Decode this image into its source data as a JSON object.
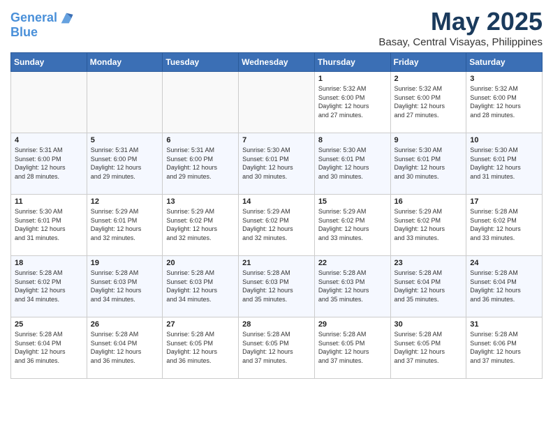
{
  "header": {
    "logo_line1": "General",
    "logo_line2": "Blue",
    "month_year": "May 2025",
    "location": "Basay, Central Visayas, Philippines"
  },
  "weekdays": [
    "Sunday",
    "Monday",
    "Tuesday",
    "Wednesday",
    "Thursday",
    "Friday",
    "Saturday"
  ],
  "weeks": [
    [
      {
        "day": "",
        "content": ""
      },
      {
        "day": "",
        "content": ""
      },
      {
        "day": "",
        "content": ""
      },
      {
        "day": "",
        "content": ""
      },
      {
        "day": "1",
        "content": "Sunrise: 5:32 AM\nSunset: 6:00 PM\nDaylight: 12 hours\nand 27 minutes."
      },
      {
        "day": "2",
        "content": "Sunrise: 5:32 AM\nSunset: 6:00 PM\nDaylight: 12 hours\nand 27 minutes."
      },
      {
        "day": "3",
        "content": "Sunrise: 5:32 AM\nSunset: 6:00 PM\nDaylight: 12 hours\nand 28 minutes."
      }
    ],
    [
      {
        "day": "4",
        "content": "Sunrise: 5:31 AM\nSunset: 6:00 PM\nDaylight: 12 hours\nand 28 minutes."
      },
      {
        "day": "5",
        "content": "Sunrise: 5:31 AM\nSunset: 6:00 PM\nDaylight: 12 hours\nand 29 minutes."
      },
      {
        "day": "6",
        "content": "Sunrise: 5:31 AM\nSunset: 6:00 PM\nDaylight: 12 hours\nand 29 minutes."
      },
      {
        "day": "7",
        "content": "Sunrise: 5:30 AM\nSunset: 6:01 PM\nDaylight: 12 hours\nand 30 minutes."
      },
      {
        "day": "8",
        "content": "Sunrise: 5:30 AM\nSunset: 6:01 PM\nDaylight: 12 hours\nand 30 minutes."
      },
      {
        "day": "9",
        "content": "Sunrise: 5:30 AM\nSunset: 6:01 PM\nDaylight: 12 hours\nand 30 minutes."
      },
      {
        "day": "10",
        "content": "Sunrise: 5:30 AM\nSunset: 6:01 PM\nDaylight: 12 hours\nand 31 minutes."
      }
    ],
    [
      {
        "day": "11",
        "content": "Sunrise: 5:30 AM\nSunset: 6:01 PM\nDaylight: 12 hours\nand 31 minutes."
      },
      {
        "day": "12",
        "content": "Sunrise: 5:29 AM\nSunset: 6:01 PM\nDaylight: 12 hours\nand 32 minutes."
      },
      {
        "day": "13",
        "content": "Sunrise: 5:29 AM\nSunset: 6:02 PM\nDaylight: 12 hours\nand 32 minutes."
      },
      {
        "day": "14",
        "content": "Sunrise: 5:29 AM\nSunset: 6:02 PM\nDaylight: 12 hours\nand 32 minutes."
      },
      {
        "day": "15",
        "content": "Sunrise: 5:29 AM\nSunset: 6:02 PM\nDaylight: 12 hours\nand 33 minutes."
      },
      {
        "day": "16",
        "content": "Sunrise: 5:29 AM\nSunset: 6:02 PM\nDaylight: 12 hours\nand 33 minutes."
      },
      {
        "day": "17",
        "content": "Sunrise: 5:28 AM\nSunset: 6:02 PM\nDaylight: 12 hours\nand 33 minutes."
      }
    ],
    [
      {
        "day": "18",
        "content": "Sunrise: 5:28 AM\nSunset: 6:02 PM\nDaylight: 12 hours\nand 34 minutes."
      },
      {
        "day": "19",
        "content": "Sunrise: 5:28 AM\nSunset: 6:03 PM\nDaylight: 12 hours\nand 34 minutes."
      },
      {
        "day": "20",
        "content": "Sunrise: 5:28 AM\nSunset: 6:03 PM\nDaylight: 12 hours\nand 34 minutes."
      },
      {
        "day": "21",
        "content": "Sunrise: 5:28 AM\nSunset: 6:03 PM\nDaylight: 12 hours\nand 35 minutes."
      },
      {
        "day": "22",
        "content": "Sunrise: 5:28 AM\nSunset: 6:03 PM\nDaylight: 12 hours\nand 35 minutes."
      },
      {
        "day": "23",
        "content": "Sunrise: 5:28 AM\nSunset: 6:04 PM\nDaylight: 12 hours\nand 35 minutes."
      },
      {
        "day": "24",
        "content": "Sunrise: 5:28 AM\nSunset: 6:04 PM\nDaylight: 12 hours\nand 36 minutes."
      }
    ],
    [
      {
        "day": "25",
        "content": "Sunrise: 5:28 AM\nSunset: 6:04 PM\nDaylight: 12 hours\nand 36 minutes."
      },
      {
        "day": "26",
        "content": "Sunrise: 5:28 AM\nSunset: 6:04 PM\nDaylight: 12 hours\nand 36 minutes."
      },
      {
        "day": "27",
        "content": "Sunrise: 5:28 AM\nSunset: 6:05 PM\nDaylight: 12 hours\nand 36 minutes."
      },
      {
        "day": "28",
        "content": "Sunrise: 5:28 AM\nSunset: 6:05 PM\nDaylight: 12 hours\nand 37 minutes."
      },
      {
        "day": "29",
        "content": "Sunrise: 5:28 AM\nSunset: 6:05 PM\nDaylight: 12 hours\nand 37 minutes."
      },
      {
        "day": "30",
        "content": "Sunrise: 5:28 AM\nSunset: 6:05 PM\nDaylight: 12 hours\nand 37 minutes."
      },
      {
        "day": "31",
        "content": "Sunrise: 5:28 AM\nSunset: 6:06 PM\nDaylight: 12 hours\nand 37 minutes."
      }
    ]
  ]
}
